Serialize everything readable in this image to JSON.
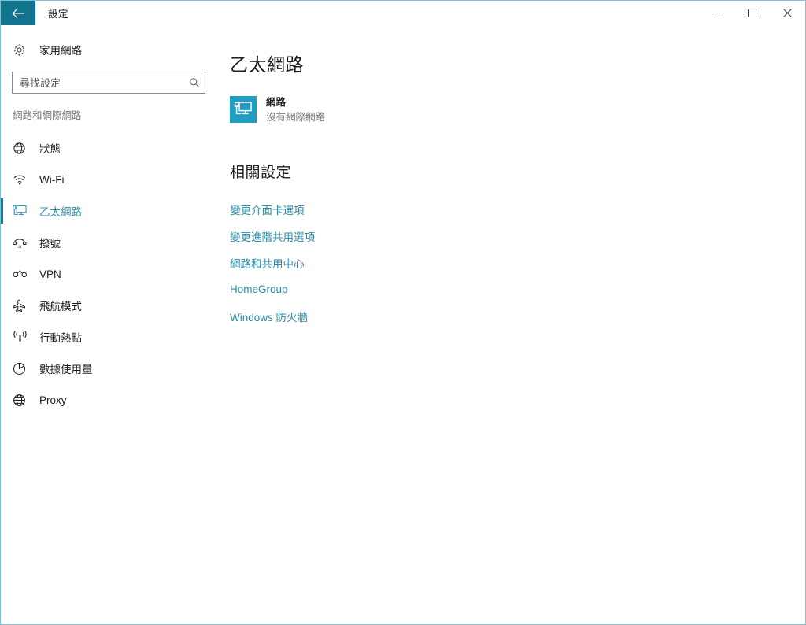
{
  "titlebar": {
    "back_icon": "back-arrow-icon",
    "title": "設定",
    "minimize_label": "–",
    "maximize_label": "□",
    "close_label": "✕"
  },
  "sidebar": {
    "home": {
      "icon": "gear-icon",
      "label": "家用網路"
    },
    "search": {
      "placeholder": "尋找設定",
      "value": "",
      "icon": "search-icon"
    },
    "section_label": "網路和網際網路",
    "items": [
      {
        "icon": "globe-status-icon",
        "label": "狀態",
        "selected": false
      },
      {
        "icon": "wifi-icon",
        "label": "Wi-Fi",
        "selected": false
      },
      {
        "icon": "ethernet-icon",
        "label": "乙太網路",
        "selected": true
      },
      {
        "icon": "dialup-phone-icon",
        "label": "撥號",
        "selected": false
      },
      {
        "icon": "vpn-icon",
        "label": "VPN",
        "selected": false
      },
      {
        "icon": "airplane-icon",
        "label": "飛航模式",
        "selected": false
      },
      {
        "icon": "hotspot-icon",
        "label": "行動熱點",
        "selected": false
      },
      {
        "icon": "data-usage-icon",
        "label": "數據使用量",
        "selected": false
      },
      {
        "icon": "proxy-globe-icon",
        "label": "Proxy",
        "selected": false
      }
    ]
  },
  "main": {
    "page_title": "乙太網路",
    "status": {
      "icon": "ethernet-monitor-icon",
      "name": "網路",
      "sub": "沒有網際網路"
    },
    "related_title": "相關設定",
    "links": [
      "變更介面卡選項",
      "變更進階共用選項",
      "網路和共用中心",
      "HomeGroup",
      "Windows 防火牆"
    ]
  },
  "colors": {
    "accent_teal": "#12748c",
    "accent_selected": "#15809a",
    "link": "#2b8ca4",
    "status_tile": "#1f9ec1",
    "window_border": "#7ec3d4",
    "muted_text": "#767676"
  }
}
